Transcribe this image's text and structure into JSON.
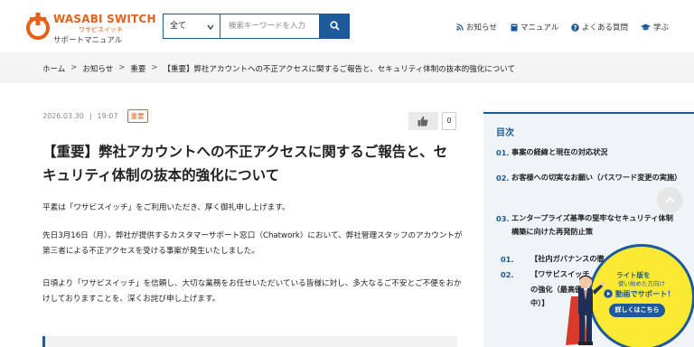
{
  "header": {
    "logo_title": "WASABI SWITCH",
    "logo_sub": "ワサビスイッチ",
    "logo_support": "サポートマニュアル",
    "search_select": "全て",
    "search_placeholder": "検索キーワードを入力",
    "nav": [
      "お知らせ",
      "マニュアル",
      "よくある質問",
      "学ぶ"
    ]
  },
  "breadcrumb": [
    "ホーム",
    "お知らせ",
    "重要",
    "【重要】弊社アカウントへの不正アクセスに関するご報告と、セキュリティ体制の抜本的強化について"
  ],
  "article": {
    "date": "2026.03.30",
    "time": "19:07",
    "badge": "重要",
    "like_count": "0",
    "title": "【重要】弊社アカウントへの不正アクセスに関するご報告と、セキュリティ体制の抜本的強化について",
    "p1": "平素は「ワサビスイッチ」をご利用いただき、厚く御礼申し上げます。",
    "p2": "先日3月16日（月）、弊社が提供するカスタマーサポート窓口（Chatwork）において、弊社管理スタッフのアカウントが第三者による不正アクセスを受ける事案が発生いたしました。",
    "p3": "日頃より「ワサビスイッチ」を信頼し、大切な業務をお任せいただいている皆様に対し、多大なるご不安とご不便をおかけしておりますことを、深くお詫び申し上げます。"
  },
  "toc": {
    "title": "目次",
    "items": [
      {
        "num": "01.",
        "label": "事案の経緯と現在の対応状況"
      },
      {
        "num": "02.",
        "label": "お客様への切実なお願い（パスワード変更の実施）"
      },
      {
        "num": "03.",
        "label": "エンタープライズ基準の堅牢なセキュリティ体制構築に向けた再発防止策"
      }
    ],
    "sub_items": [
      {
        "num": "01.",
        "label": "【社内ガバナンスの徹"
      },
      {
        "num": "02.",
        "label": "【ワサビスイッチ"
      }
    ],
    "sub_tail": "の強化（最高優先\n中）】"
  },
  "promo": {
    "line1": "ライト版を",
    "line2": "使い始めた方向け",
    "line3": "動画でサポート！",
    "button": "詳しくはこちら"
  },
  "colors": {
    "brand_orange": "#e2611b",
    "brand_blue": "#1d5a9c",
    "promo_yellow": "#fce934"
  }
}
